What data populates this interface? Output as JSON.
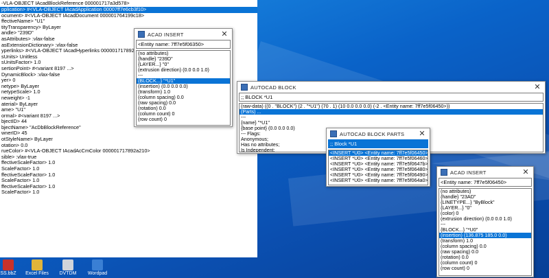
{
  "main": {
    "title": "-VLA-OBJECT IAcadBlockReference 000001717a3d578>",
    "rows": [
      "pplication>  #<VLA-OBJECT IAcadApplication 00007ff7e6cb3f10>",
      "ocument>  #<VLA-OBJECT IAcadDocument 000001764199c18>",
      "ffectiveName>  \"U1\"",
      "tityTransparency>  ByLayer",
      "andle>  \"239D\"",
      "asAttributes>  :vlax-false",
      "asExtensionDictionary>  :vlax-false",
      "yperlinks>  #<VLA-OBJECT IAcadHyperlinks 000001717892978>",
      "sUnits>  Unitless",
      "sUnitsFactor>  1.0",
      "sertionPoint>  #<variant 8197 ...>",
      "DynamicBlock>  :vlax-false",
      "yer>  0",
      "netype>  ByLayer",
      "netypeScale>  1.0",
      "neweight>  -1",
      "aterial>  ByLayer",
      "ame>  \"U1\"",
      "ormal>  #<variant 8197 ...>",
      "bjectID>  44",
      "bjectName>  \"AcDbBlockReference\"",
      "wnerID>  45",
      "otStyleName>  ByLayer",
      "otation>  0.0",
      "rueColor>  #<VLA-OBJECT IAcadAcCmColor 000001717892a210>",
      "sible>  :vlax-true",
      "ffectiveScaleFactor>  1.0",
      "ScaleFactor>  1.0",
      "ffectiveScaleFactor>  1.0",
      "ScaleFactor>  1.0",
      "ffectiveScaleFactor>  1.0",
      "ScaleFactor>  1.0"
    ],
    "selected_row": 0
  },
  "insert1": {
    "title": "ACAD INSERT",
    "entity": "<Entity name: 7ff7e5f06350>",
    "rows": [
      "(no attributes)",
      "{handle} \"239D\"",
      "{LAYER...} \"0\"",
      "(extrusion direction) (0.0 0.0 1.0)",
      "---",
      "{BLOCK...} \"*U1\"",
      "(insertion) (0.0 0.0 0.0)",
      "(transform) 1.0",
      "(column spacing) 0.0",
      "(raw spacing) 0.0",
      "(rotation) 0.0",
      "(column count) 0",
      "(row count) 0"
    ],
    "selected_row": 5
  },
  "block": {
    "title": "AUTOCAD BLOCK",
    "entity": ";; BLOCK *U1",
    "rows": [
      "(raw-data) ((0 . \"BLOCK\") (2 . \"*U1\") (70 . 1) (10 0.0 0.0 0.0) (-2 . <Entity name: 7ff7e5f06450>))",
      "(Parts) ...",
      "---",
      "{name} \"*U1\"",
      "{base point} (0.0 0.0 0.0)",
      "--- Flags:",
      "Anonymous;",
      "Has no attributes;",
      "Is Independent;"
    ],
    "selected_row": 1
  },
  "parts": {
    "title": "AUTOCAD BLOCK PARTS",
    "entity": ";; Block *U1",
    "rows": [
      "<INSERT *U0>  <Entity name: 7ff7e5f06450>",
      "<INSERT *U0>  <Entity name: 7ff7e5f06460>",
      "<INSERT *U0>  <Entity name: 7ff7e5f0647b>",
      "<INSERT *U0>  <Entity name: 7ff7e5f06480>",
      "<INSERT *U0>  <Entity name: 7ff7e5f06490>",
      "<INSERT *U0>  <Entity name: 7ff7e5f064a0>"
    ],
    "selected_row": 0
  },
  "insert2": {
    "title": "ACAD INSERT",
    "entity": "<Entity name: 7ff7e5f06450>",
    "rows": [
      "(no attributes)",
      "{handle} \"23AD\"",
      "{LINETYPE...} \"ByBlock\"",
      "{LAYER...} \"0\"",
      "(color) 0",
      "(extrusion direction) (0.0 0.0 1.0)",
      "---",
      "{BLOCK...} \"*U0\"",
      "(insertion) (136.875 185.0 0.0)",
      "(transform) 1.0",
      "(column spacing) 0.0",
      "(raw spacing) 0.0",
      "(rotation) 0.0",
      "(column count) 0",
      "(row count) 0"
    ],
    "selected_row": 8
  },
  "taskbar": {
    "items": [
      "SS.bbZ",
      "Excel Files",
      "DVTDM",
      "Wordpad"
    ]
  },
  "colors": {
    "selection": "#0a74d6",
    "desktop": "#0b5cc4"
  },
  "icons": [
    "window-icon",
    "close-icon"
  ]
}
